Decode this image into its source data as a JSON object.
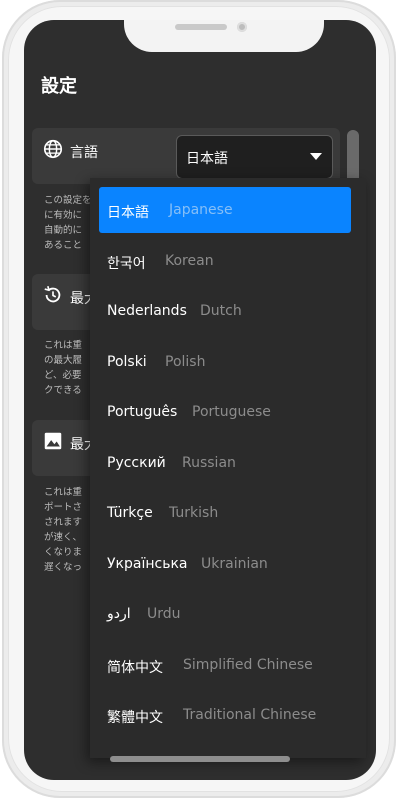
{
  "page": {
    "title": "設定"
  },
  "settings": {
    "language": {
      "label": "言語",
      "selected": "日本語",
      "desc_lines": [
        "この設定を",
        "に有効に",
        "自動的に",
        "あること"
      ]
    },
    "history": {
      "label": "最大",
      "desc_lines": [
        "これは重",
        "の最大履",
        "ど、必要",
        "クできる"
      ]
    },
    "images": {
      "label": "最大",
      "desc_lines": [
        "これは重",
        "ポートさ",
        "されます",
        "が速く、",
        "くなりま",
        "遅くなっ"
      ]
    }
  },
  "dropdown": {
    "options": [
      {
        "native": "日本語",
        "english": "Japanese",
        "selected": true
      },
      {
        "native": "한국어",
        "english": "Korean"
      },
      {
        "native": "Nederlands",
        "english": "Dutch"
      },
      {
        "native": "Polski",
        "english": "Polish"
      },
      {
        "native": "Português",
        "english": "Portuguese"
      },
      {
        "native": "Русский",
        "english": "Russian"
      },
      {
        "native": "Türkçe",
        "english": "Turkish"
      },
      {
        "native": "Українська",
        "english": "Ukrainian"
      },
      {
        "native": "اردو",
        "english": "Urdu"
      },
      {
        "native": "简体中文",
        "english": "Simplified Chinese"
      },
      {
        "native": "繁體中文",
        "english": "Traditional Chinese"
      }
    ]
  },
  "colors": {
    "accent": "#0a84ff",
    "background": "#2e2e2e",
    "card": "#3a3a3a"
  },
  "icons": {
    "language": "globe-icon",
    "history": "history-icon",
    "images": "image-icon",
    "select": "chevron-down-icon"
  }
}
